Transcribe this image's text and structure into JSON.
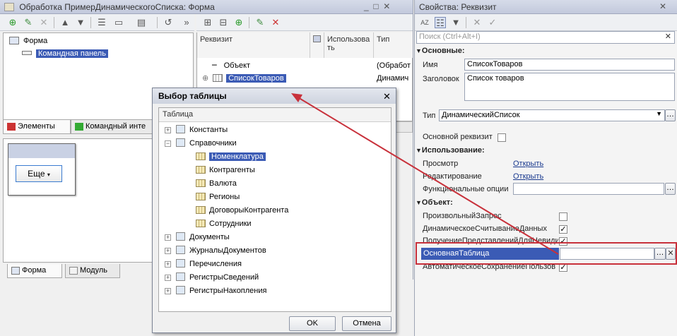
{
  "form_window": {
    "title": "Обработка ПримерДинамическогоСписка: Форма",
    "tree": [
      "Форма",
      "Командная панель"
    ],
    "tabs": [
      "Элементы",
      "Командный инте"
    ],
    "preview_button": "Еще",
    "bottom_tabs": [
      "Форма",
      "Модуль"
    ]
  },
  "attributes": {
    "columns": [
      "Реквизит",
      "Использовать",
      "Тип"
    ],
    "rows": [
      {
        "name": "Объект",
        "type": "(Обработ"
      },
      {
        "name": "СписокТоваров",
        "type": "Динамич"
      }
    ]
  },
  "dialog": {
    "title": "Выбор таблицы",
    "column": "Таблица",
    "tree": [
      {
        "label": "Константы",
        "level": 0,
        "expanded": false
      },
      {
        "label": "Справочники",
        "level": 0,
        "expanded": true
      },
      {
        "label": "Номенклатура",
        "level": 1,
        "selected": true
      },
      {
        "label": "Контрагенты",
        "level": 1
      },
      {
        "label": "Валюта",
        "level": 1
      },
      {
        "label": "Регионы",
        "level": 1
      },
      {
        "label": "ДоговорыКонтрагента",
        "level": 1
      },
      {
        "label": "Сотрудники",
        "level": 1
      },
      {
        "label": "Документы",
        "level": 0,
        "expanded": false
      },
      {
        "label": "ЖурналыДокументов",
        "level": 0,
        "expanded": false
      },
      {
        "label": "Перечисления",
        "level": 0,
        "expanded": false
      },
      {
        "label": "РегистрыСведений",
        "level": 0,
        "expanded": false
      },
      {
        "label": "РегистрыНакопления",
        "level": 0,
        "expanded": false
      }
    ],
    "ok": "OK",
    "cancel": "Отмена"
  },
  "properties": {
    "title": "Свойства: Реквизит",
    "search_placeholder": "Поиск (Ctrl+Alt+I)",
    "sections": {
      "main": "Основные:",
      "usage": "Использование:",
      "object": "Объект:"
    },
    "name_label": "Имя",
    "name_value": "СписокТоваров",
    "caption_label": "Заголовок",
    "caption_value": "Список товаров",
    "type_label": "Тип",
    "type_value": "ДинамическийСписок",
    "main_attr_label": "Основной реквизит",
    "view_label": "Просмотр",
    "view_link": "Открыть",
    "edit_label": "Редактирование",
    "edit_link": "Открыть",
    "func_options_label": "Функциональные опции",
    "custom_query_label": "ПроизвольныйЗапрос",
    "dynamic_read_label": "ДинамическоеСчитываниеДанных",
    "get_views_label": "ПолучениеПредставленийДляНевиди",
    "main_table_label": "ОсновнаяТаблица",
    "autosave_label": "АвтоматическоеСохранениеПользов"
  },
  "colors": {
    "selection": "#3b5bb5",
    "highlight_box": "#c8313b",
    "arrow": "#c8313b"
  }
}
